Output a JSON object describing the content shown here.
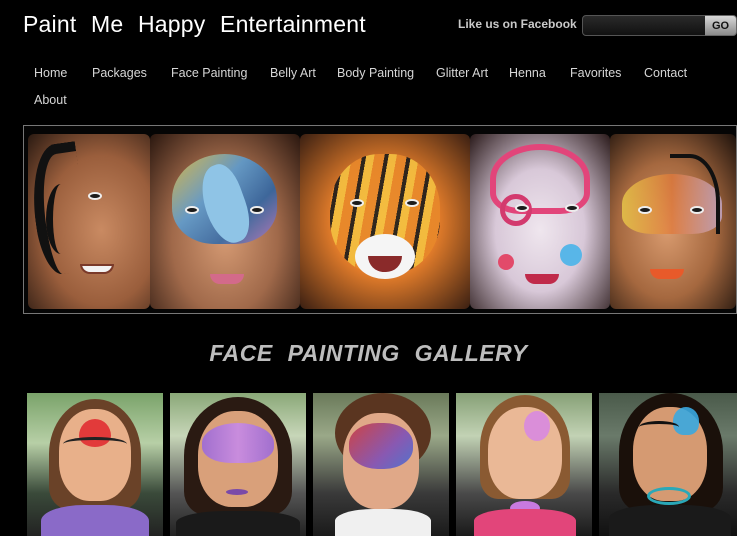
{
  "header": {
    "site_title": "Paint  Me  Happy  Entertainment",
    "facebook_link": "Like us on Facebook",
    "search": {
      "value": "",
      "placeholder": ""
    },
    "go_label": "GO"
  },
  "nav": {
    "items": [
      {
        "label": "Home"
      },
      {
        "label": "Packages"
      },
      {
        "label": "Face Painting"
      },
      {
        "label": "Belly Art"
      },
      {
        "label": "Body Painting"
      },
      {
        "label": "Glitter Art"
      },
      {
        "label": "Henna"
      },
      {
        "label": "Favorites"
      },
      {
        "label": "Contact"
      },
      {
        "label": "About"
      }
    ]
  },
  "gallery": {
    "title": "FACE  PAINTING  GALLERY"
  },
  "colors": {
    "background": "#000000",
    "nav_text": "#d6d6d6",
    "gallery_title": "#bdbdbd"
  }
}
